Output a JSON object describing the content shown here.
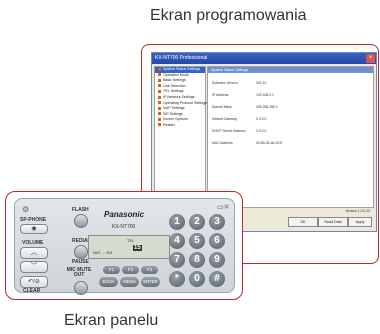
{
  "captions": {
    "top": "Ekran programowania",
    "bottom": "Ekran panelu"
  },
  "window": {
    "title": "KX-NT700 Professional",
    "tree_items": [
      "System Status Settings",
      "Operation Mode",
      "Basic Settings",
      "Line Selection",
      "TEL Settings",
      "IP Network Settings",
      "Operating Protocol Settings",
      "VoIP Settings",
      "SIP Settings",
      "Screen Options",
      "Restart"
    ],
    "main_header": "System Status Settings",
    "fields": [
      {
        "label": "Software Version",
        "value": "002.10"
      },
      {
        "label": "IP Address",
        "value": "192.168.0.1"
      },
      {
        "label": "Subnet Mask",
        "value": "255.255.255.0"
      },
      {
        "label": "Default Gateway",
        "value": "0.0.0.0"
      },
      {
        "label": "DHCP Server Address",
        "value": "0.0.0.0"
      },
      {
        "label": "MAC Address",
        "value": "00-80-45-a0-2f-f0"
      }
    ],
    "version": "Version 1.0.0.20",
    "buttons": [
      "OK",
      "Read Data",
      "Apply"
    ]
  },
  "panel": {
    "brand": "Panasonic",
    "model": "KX-NT700",
    "lcd_lines": [
      "TEL",
      "15",
      "NAT ... 001"
    ],
    "sp_phone": "SP-PHONE",
    "volume": "VOLUME",
    "clear": "CLEAR",
    "flash": "FLASH",
    "redial": "REDIAL",
    "pause": "PAUSE",
    "mic_mute": "MIC MUTE OUT",
    "fkeys": [
      "F1",
      "F2",
      "F3"
    ],
    "bottom_keys": [
      "BACK",
      "MENU",
      "ENTER"
    ],
    "digits": [
      "1",
      "2",
      "3",
      "4",
      "5",
      "6",
      "7",
      "8",
      "9",
      "*",
      "0",
      "#"
    ]
  }
}
